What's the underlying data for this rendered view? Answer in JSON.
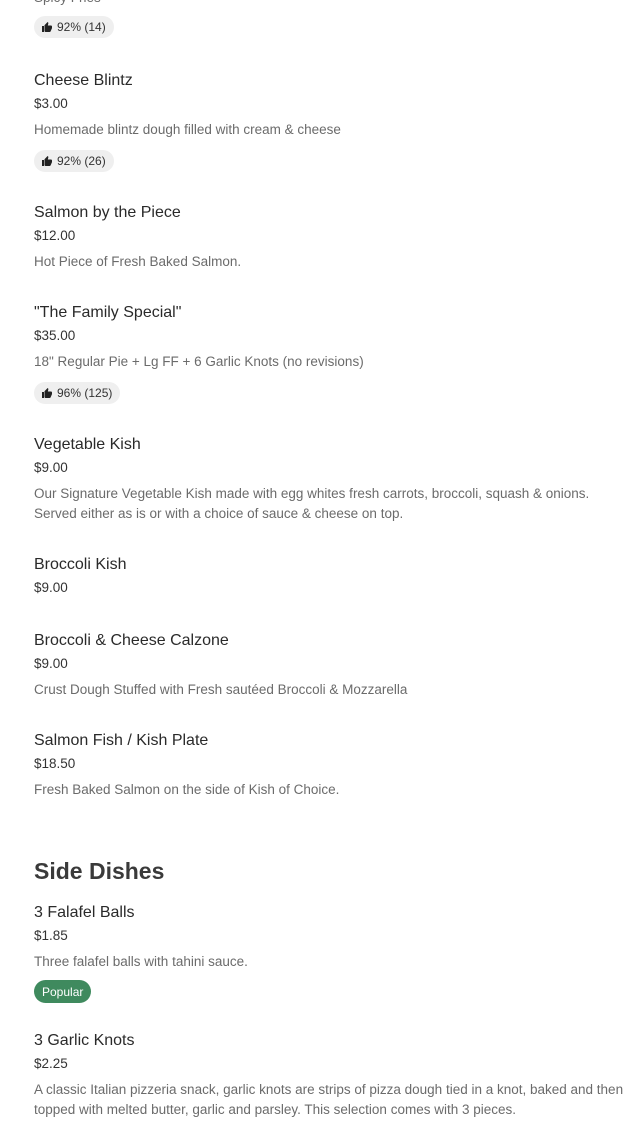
{
  "top_partial": {
    "desc": "Spicy Fries",
    "rating": "92% (14)"
  },
  "items": [
    {
      "name": "Cheese Blintz",
      "price": "$3.00",
      "desc": "Homemade blintz dough filled with cream & cheese",
      "rating": "92% (26)"
    },
    {
      "name": "Salmon by the Piece",
      "price": "$12.00",
      "desc": "Hot Piece of Fresh Baked Salmon."
    },
    {
      "name": "\"The Family Special\"",
      "price": "$35.00",
      "desc": "18\" Regular Pie + Lg FF + 6 Garlic Knots (no revisions)",
      "rating": "96% (125)"
    },
    {
      "name": "Vegetable Kish",
      "price": "$9.00",
      "desc": "Our Signature Vegetable Kish made with egg whites fresh carrots, broccoli, squash & onions. Served either as is or with a choice of sauce & cheese on top."
    },
    {
      "name": "Broccoli Kish",
      "price": "$9.00"
    },
    {
      "name": "Broccoli & Cheese Calzone",
      "price": "$9.00",
      "desc": "Crust Dough Stuffed with Fresh sautéed Broccoli & Mozzarella"
    },
    {
      "name": "Salmon Fish / Kish Plate",
      "price": "$18.50",
      "desc": "Fresh Baked Salmon on the side of Kish of Choice."
    }
  ],
  "side_dishes": {
    "title": "Side Dishes",
    "items": [
      {
        "name": "3 Falafel Balls",
        "price": "$1.85",
        "desc": "Three falafel balls with tahini sauce.",
        "badge": "Popular"
      },
      {
        "name": "3 Garlic Knots",
        "price": "$2.25",
        "desc": "A classic Italian pizzeria snack, garlic knots are strips of pizza dough tied in a knot, baked and then topped with melted butter, garlic and parsley. This selection comes with 3 pieces."
      }
    ]
  },
  "colors": {
    "popular_badge": "#3f8a5e",
    "rating_badge_bg": "#efefef"
  },
  "icons": {
    "rating": "thumbs-up-icon"
  }
}
